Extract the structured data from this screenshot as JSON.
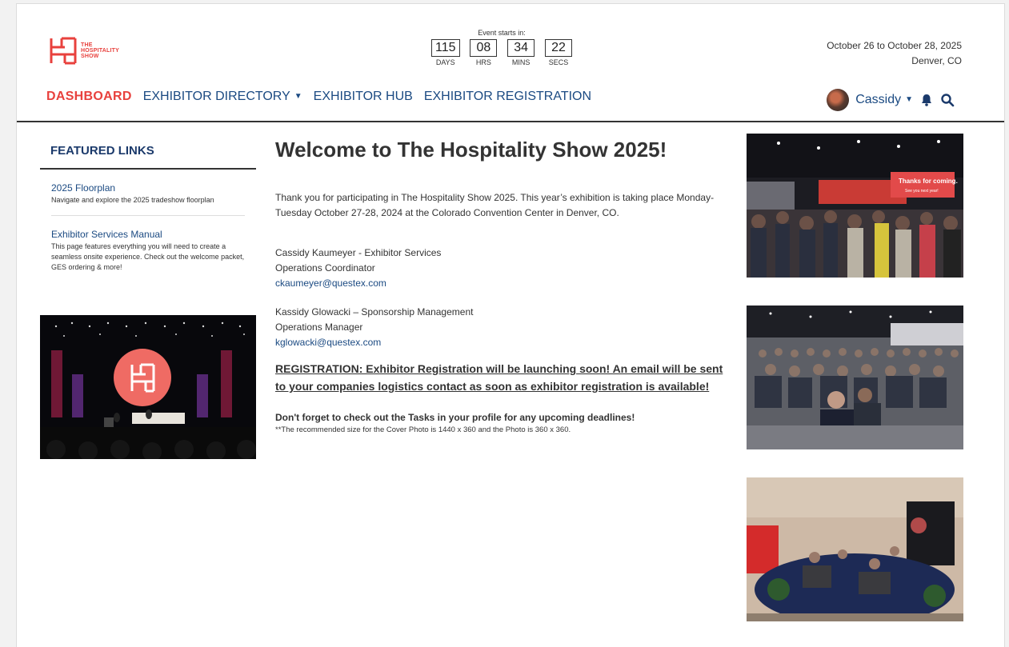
{
  "brand": {
    "logo_lines": [
      "THE",
      "HOSPITALITY",
      "SHOW"
    ],
    "accent_color": "#e8413d",
    "link_color": "#1b4a82"
  },
  "countdown": {
    "label": "Event starts in:",
    "units": [
      {
        "value": "115",
        "label": "DAYS"
      },
      {
        "value": "08",
        "label": "HRS"
      },
      {
        "value": "34",
        "label": "MINS"
      },
      {
        "value": "22",
        "label": "SECS"
      }
    ]
  },
  "event": {
    "dates": "October 26 to October 28, 2025",
    "location": "Denver, CO"
  },
  "nav": {
    "items": [
      {
        "label": "DASHBOARD",
        "active": true
      },
      {
        "label": "EXHIBITOR DIRECTORY",
        "dropdown": true
      },
      {
        "label": "EXHIBITOR HUB"
      },
      {
        "label": "EXHIBITOR REGISTRATION"
      }
    ]
  },
  "user": {
    "name": "Cassidy",
    "icons": [
      "bell-icon",
      "search-icon"
    ]
  },
  "featured": {
    "title": "FEATURED LINKS",
    "links": [
      {
        "title": "2025 Floorplan",
        "desc": "Navigate and explore the 2025 tradeshow floorplan"
      },
      {
        "title": "Exhibitor Services Manual",
        "desc": "This page features everything you will need to create a seamless onsite experience. Check out the welcome packet, GES ordering & more!"
      }
    ]
  },
  "main": {
    "title": "Welcome to The Hospitality Show 2025!",
    "intro": "Thank you for participating in The Hospitality Show 2025. This year’s exhibition is taking place Monday-Tuesday October 27-28, 2024 at the Colorado Convention Center in Denver, CO.",
    "contacts": [
      {
        "line1": "Cassidy Kaumeyer - Exhibitor Services",
        "line2": "Operations Coordinator",
        "email": "ckaumeyer@questex.com"
      },
      {
        "line1": "Kassidy Glowacki – Sponsorship Management",
        "line2": "Operations Manager",
        "email": "kglowacki@questex.com"
      }
    ],
    "registration_note": "REGISTRATION: Exhibitor Registration will be launching soon! An email will be sent to your companies logistics contact as soon as exhibitor registration is available!",
    "tasks_note": "Don't forget to check out the Tasks in your profile for any upcoming deadlines!",
    "size_note": "**The recommended size for the Cover Photo is 1440 x 360 and the Photo is 360 x 360."
  },
  "photos": {
    "banner_text": [
      "Thanks for coming.",
      "See you next year!"
    ]
  }
}
